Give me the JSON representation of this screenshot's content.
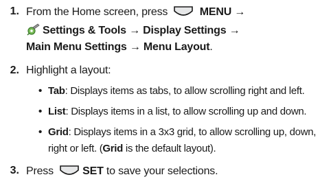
{
  "steps": [
    {
      "number": "1.",
      "line1_pre": "From the Home screen, press",
      "line1_key_icon": "menu-key-icon",
      "line1_post": "MENU →",
      "line2_icon": "settings-tools-icon",
      "line2": "Settings & Tools → Display Settings →",
      "line3_bold": "Main Menu Settings → Menu Layout",
      "line3_end": "."
    },
    {
      "number": "2.",
      "text": "Highlight a layout:",
      "bullets": [
        {
          "term": "Tab",
          "desc": ": Displays items as tabs, to allow scrolling right and left."
        },
        {
          "term": "List",
          "desc": ": Displays items in a list, to allow scrolling up and down."
        },
        {
          "term": "Grid",
          "desc": ": Displays items in a 3x3 grid, to allow scrolling up, down,",
          "cont_pre": "right or left. (",
          "cont_bold": "Grid",
          "cont_post": " is the default layout)."
        }
      ]
    },
    {
      "number": "3.",
      "pre": "Press",
      "key_icon": "set-key-icon",
      "bold": "SET",
      "post": " to save your selections."
    }
  ],
  "colors": {
    "key_fill": "#e6e7e8",
    "key_stroke": "#1a1a1a",
    "gear": "#3a8a3a"
  }
}
